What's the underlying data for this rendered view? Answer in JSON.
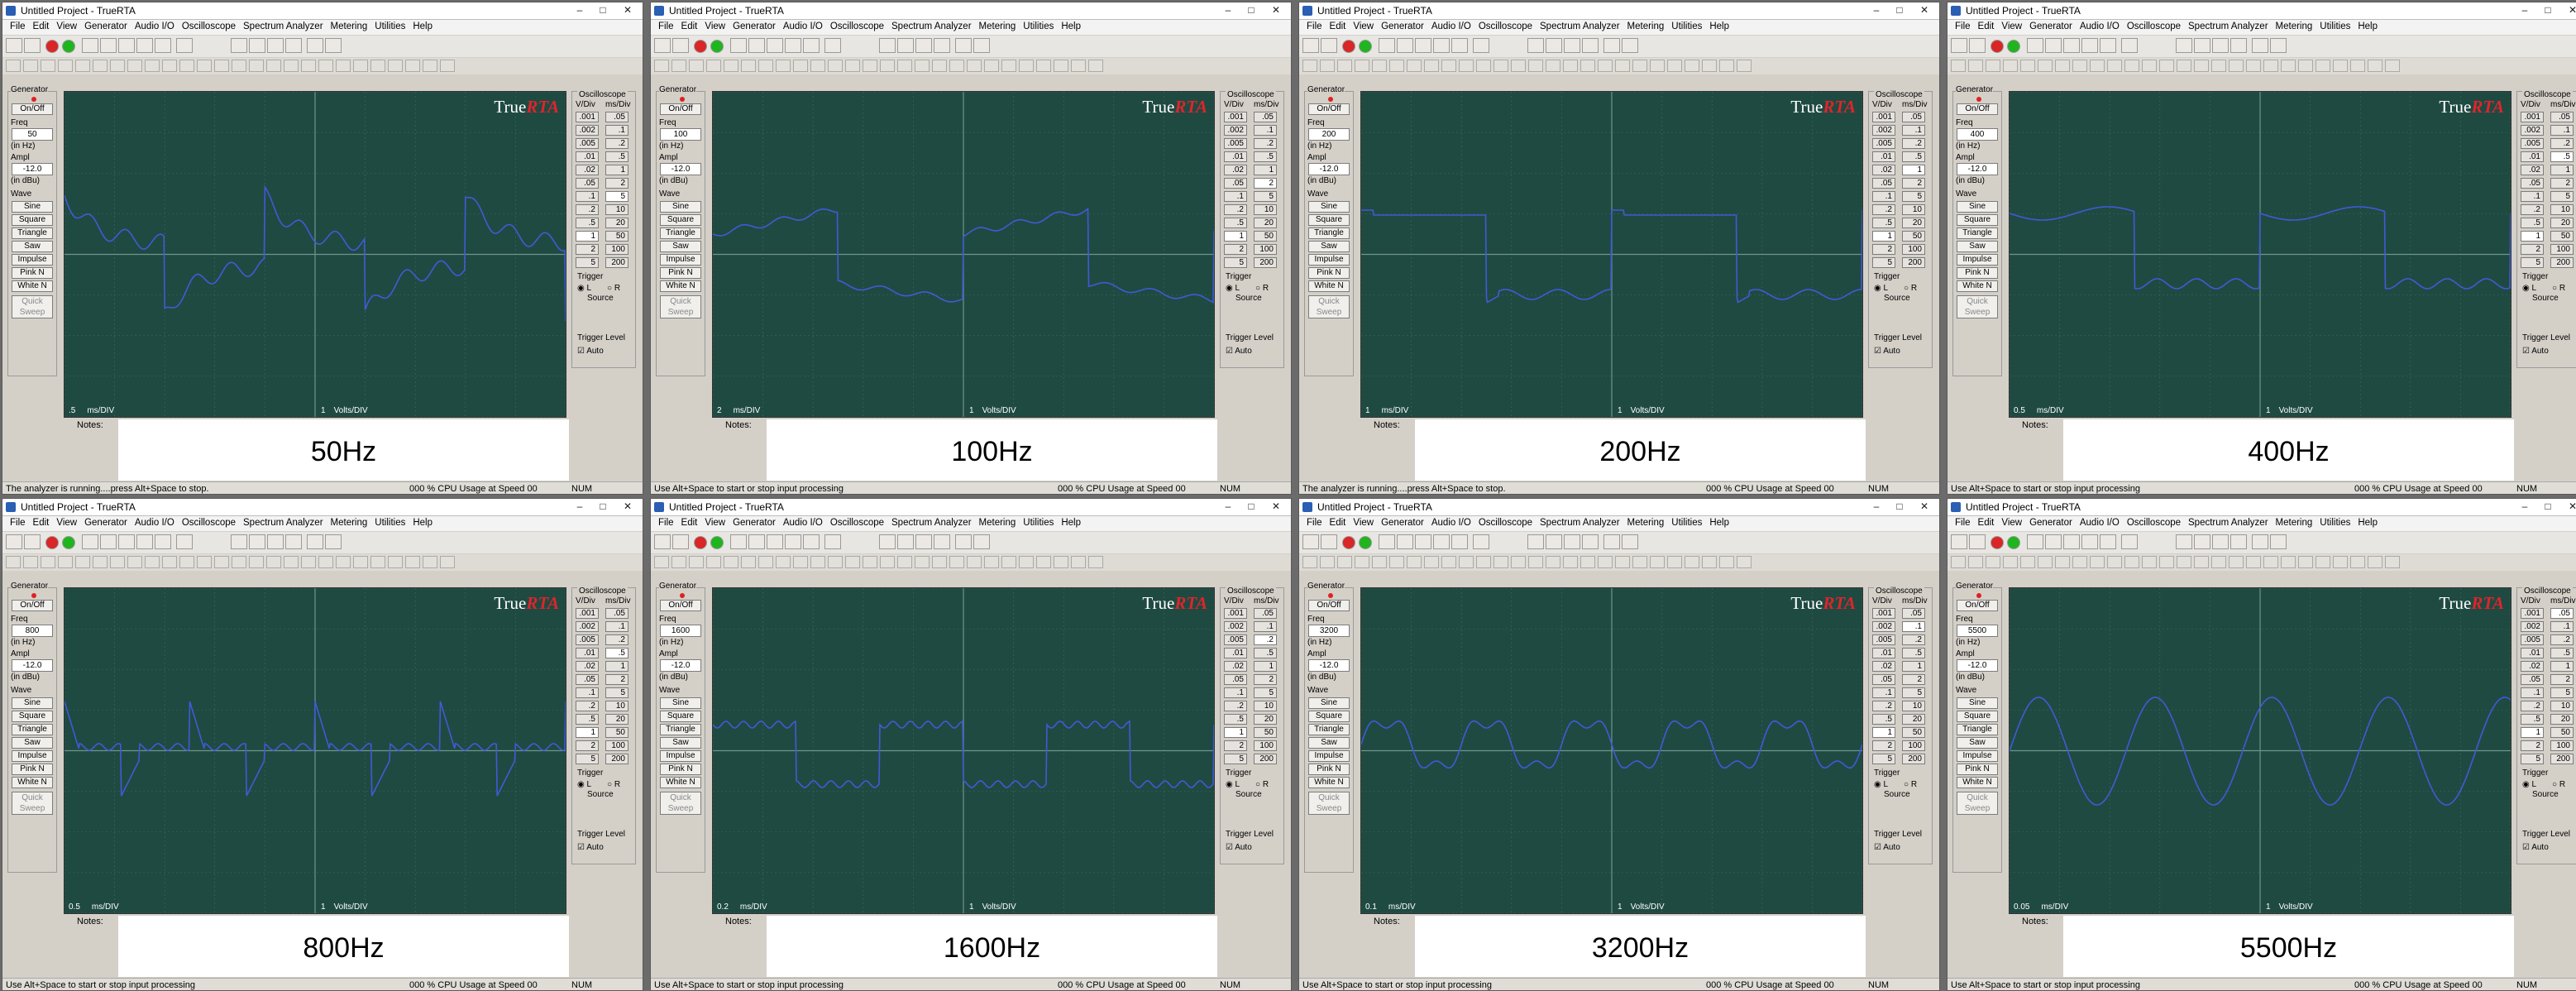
{
  "window": {
    "title": "Untitled Project - TrueRTA",
    "min": "–",
    "max": "□",
    "close": "✕"
  },
  "menus": [
    "File",
    "Edit",
    "View",
    "Generator",
    "Audio I/O",
    "Oscilloscope",
    "Spectrum Analyzer",
    "Metering",
    "Utilities",
    "Help"
  ],
  "toolbar_icons": [
    "graph-icon",
    "peak-icon",
    "record-icon",
    "run-icon",
    "1/1-octave-icon",
    "1/3-octave-icon",
    "1/6-octave-icon",
    "1/12-octave-icon",
    "1/24-octave-icon",
    "grid-icon",
    "mv-icon",
    "db-icon",
    "db-weight-icon",
    "settings-icon",
    "help-icon",
    "whats-this-icon"
  ],
  "generator": {
    "title": "Generator",
    "onoff": "On/Off",
    "freq_label": "Freq",
    "freq_unit": "(in Hz)",
    "ampl_label": "Ampl",
    "ampl_unit": "(in dBu)",
    "ampl_value": "-12.0",
    "wave_label": "Wave",
    "waves": [
      "Sine",
      "Square",
      "Triangle",
      "Saw",
      "Impulse",
      "Pink N",
      "White N"
    ],
    "quick_sweep": "Quick Sweep"
  },
  "oscilloscope": {
    "title": "Oscilloscope",
    "vdiv_header": "V/Div",
    "msdiv_header": "ms/Div",
    "vdiv": [
      ".001",
      ".002",
      ".005",
      ".01",
      ".02",
      ".05",
      ".1",
      ".2",
      ".5",
      "1",
      "2",
      "5"
    ],
    "msdiv": [
      ".05",
      ".1",
      ".2",
      ".5",
      "1",
      "2",
      "5",
      "10",
      "20",
      "50",
      "100",
      "200"
    ],
    "trigger_label": "Trigger",
    "trigger_l": "L",
    "trigger_r": "R",
    "source_label": "Source",
    "trigger_level": "Trigger Level",
    "auto": "Auto"
  },
  "brand": {
    "true": "True",
    "rta": "RTA"
  },
  "volts_scale": "1",
  "volts_label": "Volts/DIV",
  "ms_label": "ms/DIV",
  "notes_label": "Notes:",
  "num": "NUM",
  "panels": [
    {
      "caption": "50Hz",
      "freq": "50",
      "ms": ".5",
      "status": "The analyzer is running....press Alt+Space to stop.",
      "cpu": "000 % CPU Usage at Speed 00",
      "sel_ms": "5",
      "wave": "sawdecay"
    },
    {
      "caption": "100Hz",
      "freq": "100",
      "ms": "2",
      "status": "Use Alt+Space to start or stop input processing",
      "cpu": "000 % CPU Usage at Speed 00",
      "sel_ms": "2",
      "wave": "tilt"
    },
    {
      "caption": "200Hz",
      "freq": "200",
      "ms": "1",
      "status": "The analyzer is running....press Alt+Space to stop.",
      "cpu": "000 % CPU Usage at Speed 00",
      "sel_ms": "1",
      "wave": "square"
    },
    {
      "caption": "400Hz",
      "freq": "400",
      "ms": "0.5",
      "status": "Use Alt+Space to start or stop input processing",
      "cpu": "000 % CPU Usage at Speed 00",
      "sel_ms": ".5",
      "wave": "square2"
    },
    {
      "caption": "800Hz",
      "freq": "800",
      "ms": "0.5",
      "status": "Use Alt+Space to start or stop input processing",
      "cpu": "000 % CPU Usage at Speed 00",
      "sel_ms": ".5",
      "wave": "spikes"
    },
    {
      "caption": "1600Hz",
      "freq": "1600",
      "ms": "0.2",
      "status": "Use Alt+Space to start or stop input processing",
      "cpu": "000 % CPU Usage at Speed 00",
      "sel_ms": ".2",
      "wave": "ringsquare"
    },
    {
      "caption": "3200Hz",
      "freq": "3200",
      "ms": "0.1",
      "status": "Use Alt+Space to start or stop input processing",
      "cpu": "000 % CPU Usage at Speed 00",
      "sel_ms": ".1",
      "wave": "wobble"
    },
    {
      "caption": "5500Hz",
      "freq": "5500",
      "ms": "0.05",
      "status": "Use Alt+Space to start or stop input processing",
      "cpu": "000 % CPU Usage at Speed 00",
      "sel_ms": ".05",
      "wave": "sine"
    }
  ],
  "colors": {
    "scope_bg": "#1f4a42",
    "grid": "#3d6a61",
    "axis": "#6f958d",
    "trace": "#3f5bd6"
  }
}
